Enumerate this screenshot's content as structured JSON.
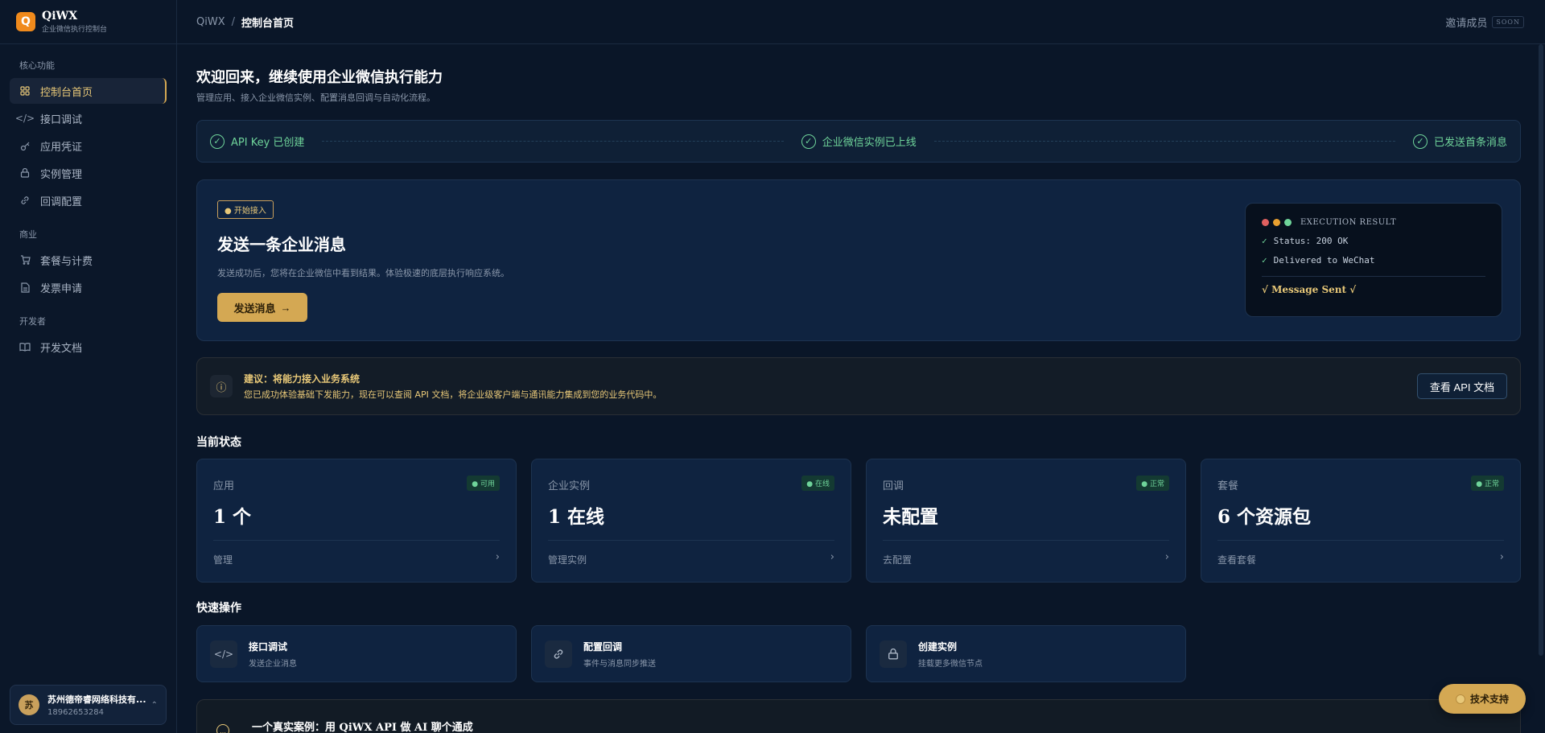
{
  "brand": {
    "logo": "Q",
    "name": "QiWX",
    "subtitle": "企业微信执行控制台"
  },
  "sidebar": {
    "sections": [
      {
        "title": "核心功能"
      },
      {
        "title": "商业"
      },
      {
        "title": "开发者"
      }
    ],
    "items": [
      {
        "label": "控制台首页",
        "icon": "grid-icon"
      },
      {
        "label": "接口调试",
        "icon": "code-icon"
      },
      {
        "label": "应用凭证",
        "icon": "key-icon"
      },
      {
        "label": "实例管理",
        "icon": "box-icon"
      },
      {
        "label": "回调配置",
        "icon": "link-icon"
      },
      {
        "label": "套餐与计费",
        "icon": "cart-icon"
      },
      {
        "label": "发票申请",
        "icon": "file-icon"
      },
      {
        "label": "开发文档",
        "icon": "book-icon"
      }
    ],
    "user": {
      "avatar": "苏",
      "name": "苏州德帝睿网络科技有...",
      "phone": "18962653284"
    }
  },
  "topbar": {
    "crumb_root": "QiWX",
    "crumb_sep": "/",
    "crumb_current": "控制台首页",
    "invite": "邀请成员",
    "soon": "SOON"
  },
  "welcome": {
    "title": "欢迎回来，继续使用企业微信执行能力",
    "subtitle": "管理应用、接入企业微信实例、配置消息回调与自动化流程。"
  },
  "steps": [
    {
      "label": "API Key 已创建"
    },
    {
      "label": "企业微信实例已上线"
    },
    {
      "label": "已发送首条消息"
    }
  ],
  "hero": {
    "badge": "● 开始接入",
    "title": "发送一条企业消息",
    "desc": "发送成功后，您将在企业微信中看到结果。体验极速的底层执行响应系统。",
    "button": "发送消息",
    "terminal": {
      "title": "EXECUTION RESULT",
      "lines": [
        "Status: 200 OK",
        "Delivered to WeChat"
      ],
      "final": "√ Message Sent √",
      "dot_colors": [
        "#e06060",
        "#e8a030",
        "#6fd49a"
      ]
    }
  },
  "tip": {
    "title": "建议：将能力接入业务系统",
    "desc": "您已成功体验基础下发能力，现在可以查阅 API 文档，将企业级客户端与通讯能力集成到您的业务代码中。",
    "button": "查看 API 文档"
  },
  "status": {
    "title": "当前状态",
    "cards": [
      {
        "label": "应用",
        "badge": "● 可用",
        "value": "1 个",
        "link": "管理"
      },
      {
        "label": "企业实例",
        "badge": "● 在线",
        "value": "1 在线",
        "link": "管理实例"
      },
      {
        "label": "回调",
        "badge": "● 正常",
        "value": "未配置",
        "link": "去配置"
      },
      {
        "label": "套餐",
        "badge": "● 正常",
        "value": "6 个资源包",
        "link": "查看套餐"
      }
    ]
  },
  "quick": {
    "title": "快速操作",
    "cards": [
      {
        "title": "接口调试",
        "desc": "发送企业消息",
        "icon": "code-icon"
      },
      {
        "title": "配置回调",
        "desc": "事件与消息同步推送",
        "icon": "link-icon"
      },
      {
        "title": "创建实例",
        "desc": "挂载更多微信节点",
        "icon": "box-icon"
      }
    ]
  },
  "case": {
    "title": "一个真实案例：用 QiWX API 做 AI 聊个通成"
  },
  "support": {
    "label": "技术支持"
  },
  "colors": {
    "accent": "#d4a853",
    "success": "#6fd49a",
    "bg": "#0a1628"
  }
}
